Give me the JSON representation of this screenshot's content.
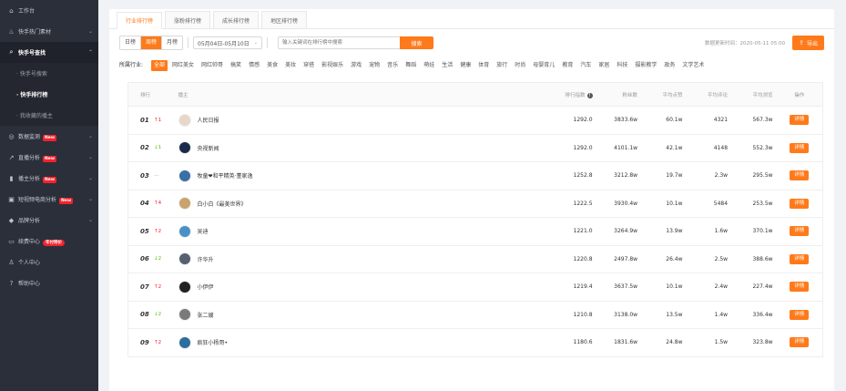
{
  "sidebar": {
    "items": [
      {
        "icon": "home-icon",
        "label": "工作台",
        "expand": false
      },
      {
        "icon": "fire-icon",
        "label": "快手热门素材",
        "expand": true
      },
      {
        "icon": "search-icon",
        "label": "快手号查找",
        "expand": true,
        "active": true
      },
      {
        "sub": true,
        "label": "· 快手号搜索"
      },
      {
        "sub": true,
        "label": "· 快手排行榜",
        "current": true
      },
      {
        "sub": true,
        "label": "· 我收藏的播主"
      },
      {
        "icon": "monitor-icon",
        "label": "数据监测",
        "badge": "New",
        "expand": true
      },
      {
        "icon": "trend-icon",
        "label": "直播分析",
        "badge": "New",
        "expand": true
      },
      {
        "icon": "bar-chart-icon",
        "label": "播主分析",
        "badge": "New",
        "expand": true
      },
      {
        "icon": "bag-icon",
        "label": "短视频电商分析",
        "badge": "New",
        "expand": true
      },
      {
        "icon": "tag-icon",
        "label": "品牌分析",
        "expand": true
      },
      {
        "icon": "calendar-icon",
        "label": "续费中心",
        "badge": "年付特价",
        "badgeRound": true
      },
      {
        "icon": "user-icon",
        "label": "个人中心"
      },
      {
        "icon": "help-icon",
        "label": "帮助中心"
      }
    ]
  },
  "tabs": [
    "行业排行榜",
    "涨粉排行榜",
    "成长排行榜",
    "地区排行榜"
  ],
  "period": [
    "日榜",
    "周榜",
    "月榜"
  ],
  "date_range": "05月04日-05月10日",
  "search": {
    "placeholder": "输入关键词在排行榜中搜索",
    "button": "搜索"
  },
  "updated": "数据更新时间：2020-05-11 05:00",
  "export_label": "导出",
  "filter": {
    "label": "所属行业:",
    "options": [
      "全部",
      "网红美女",
      "网红帅哥",
      "搞笑",
      "情感",
      "美食",
      "美妆",
      "穿搭",
      "影视娱乐",
      "游戏",
      "宠物",
      "音乐",
      "舞蹈",
      "萌娃",
      "生活",
      "健康",
      "体育",
      "旅行",
      "时尚",
      "母婴育儿",
      "教育",
      "汽车",
      "家居",
      "科技",
      "摄影教学",
      "政务",
      "文学艺术"
    ]
  },
  "table": {
    "headers": {
      "rank": "排行",
      "anchor": "播主",
      "index": "排行指数",
      "fans": "粉丝数",
      "likes": "平均点赞",
      "comments": "平均评论",
      "views": "平均浏览",
      "op": "操作"
    },
    "detail_label": "详情",
    "rows": [
      {
        "no": "01",
        "chg": "↑1",
        "dir": "down",
        "name": "人民日报",
        "index": "1292.0",
        "fans": "3833.6w",
        "likes": "60.1w",
        "comments": "4321",
        "views": "567.3w",
        "avatar": "#e8d7c8"
      },
      {
        "no": "02",
        "chg": "↓1",
        "dir": "up",
        "name": "央视新闻",
        "index": "1292.0",
        "fans": "4101.1w",
        "likes": "42.1w",
        "comments": "4148",
        "views": "552.3w",
        "avatar": "#1a2a4a"
      },
      {
        "no": "03",
        "chg": "—",
        "dir": "flat",
        "name": "牧童❤和平精英·董家逸",
        "index": "1252.8",
        "fans": "3212.8w",
        "likes": "19.7w",
        "comments": "2.3w",
        "views": "295.5w",
        "avatar": "#3a6fa8"
      },
      {
        "no": "04",
        "chg": "↑4",
        "dir": "down",
        "name": "白小白《最美世界》",
        "index": "1222.5",
        "fans": "3930.4w",
        "likes": "10.1w",
        "comments": "5484",
        "views": "253.5w",
        "avatar": "#c9a36b"
      },
      {
        "no": "05",
        "chg": "↑2",
        "dir": "down",
        "name": "吴迪",
        "index": "1221.0",
        "fans": "3264.9w",
        "likes": "13.9w",
        "comments": "1.6w",
        "views": "370.1w",
        "avatar": "#4a90c8"
      },
      {
        "no": "06",
        "chg": "↓2",
        "dir": "up",
        "name": "许华升",
        "index": "1220.8",
        "fans": "2497.8w",
        "likes": "26.4w",
        "comments": "2.5w",
        "views": "388.6w",
        "avatar": "#556070"
      },
      {
        "no": "07",
        "chg": "↑2",
        "dir": "down",
        "name": "小伊伊",
        "index": "1219.4",
        "fans": "3637.5w",
        "likes": "10.1w",
        "comments": "2.4w",
        "views": "227.4w",
        "avatar": "#222222"
      },
      {
        "no": "08",
        "chg": "↓2",
        "dir": "up",
        "name": "张二嫂",
        "index": "1210.8",
        "fans": "3138.0w",
        "likes": "13.5w",
        "comments": "1.4w",
        "views": "336.4w",
        "avatar": "#7a7a7a"
      },
      {
        "no": "09",
        "chg": "↑2",
        "dir": "down",
        "name": "疯狂小杨哥•",
        "index": "1180.6",
        "fans": "1831.6w",
        "likes": "24.8w",
        "comments": "1.5w",
        "views": "323.8w",
        "avatar": "#2c6e9c"
      }
    ]
  },
  "colors": {
    "accent": "#ff7a1a",
    "sidebar_bg": "#2b2f3a",
    "badge": "#f5222d"
  }
}
